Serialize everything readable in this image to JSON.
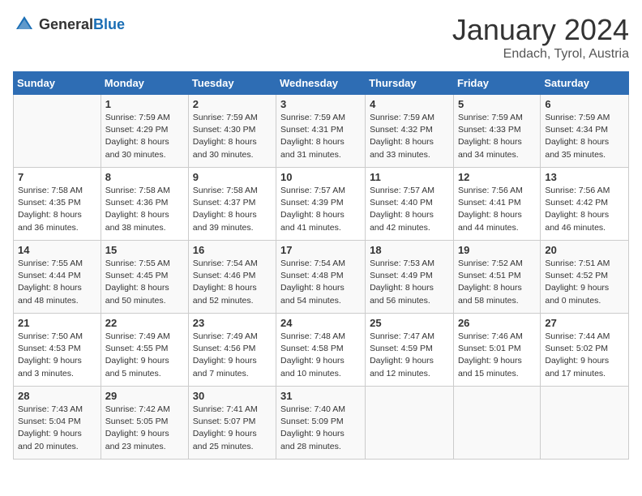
{
  "header": {
    "logo_general": "General",
    "logo_blue": "Blue",
    "title": "January 2024",
    "subtitle": "Endach, Tyrol, Austria"
  },
  "days_of_week": [
    "Sunday",
    "Monday",
    "Tuesday",
    "Wednesday",
    "Thursday",
    "Friday",
    "Saturday"
  ],
  "weeks": [
    [
      {
        "day": "",
        "info": ""
      },
      {
        "day": "1",
        "info": "Sunrise: 7:59 AM\nSunset: 4:29 PM\nDaylight: 8 hours\nand 30 minutes."
      },
      {
        "day": "2",
        "info": "Sunrise: 7:59 AM\nSunset: 4:30 PM\nDaylight: 8 hours\nand 30 minutes."
      },
      {
        "day": "3",
        "info": "Sunrise: 7:59 AM\nSunset: 4:31 PM\nDaylight: 8 hours\nand 31 minutes."
      },
      {
        "day": "4",
        "info": "Sunrise: 7:59 AM\nSunset: 4:32 PM\nDaylight: 8 hours\nand 33 minutes."
      },
      {
        "day": "5",
        "info": "Sunrise: 7:59 AM\nSunset: 4:33 PM\nDaylight: 8 hours\nand 34 minutes."
      },
      {
        "day": "6",
        "info": "Sunrise: 7:59 AM\nSunset: 4:34 PM\nDaylight: 8 hours\nand 35 minutes."
      }
    ],
    [
      {
        "day": "7",
        "info": "Sunrise: 7:58 AM\nSunset: 4:35 PM\nDaylight: 8 hours\nand 36 minutes."
      },
      {
        "day": "8",
        "info": "Sunrise: 7:58 AM\nSunset: 4:36 PM\nDaylight: 8 hours\nand 38 minutes."
      },
      {
        "day": "9",
        "info": "Sunrise: 7:58 AM\nSunset: 4:37 PM\nDaylight: 8 hours\nand 39 minutes."
      },
      {
        "day": "10",
        "info": "Sunrise: 7:57 AM\nSunset: 4:39 PM\nDaylight: 8 hours\nand 41 minutes."
      },
      {
        "day": "11",
        "info": "Sunrise: 7:57 AM\nSunset: 4:40 PM\nDaylight: 8 hours\nand 42 minutes."
      },
      {
        "day": "12",
        "info": "Sunrise: 7:56 AM\nSunset: 4:41 PM\nDaylight: 8 hours\nand 44 minutes."
      },
      {
        "day": "13",
        "info": "Sunrise: 7:56 AM\nSunset: 4:42 PM\nDaylight: 8 hours\nand 46 minutes."
      }
    ],
    [
      {
        "day": "14",
        "info": "Sunrise: 7:55 AM\nSunset: 4:44 PM\nDaylight: 8 hours\nand 48 minutes."
      },
      {
        "day": "15",
        "info": "Sunrise: 7:55 AM\nSunset: 4:45 PM\nDaylight: 8 hours\nand 50 minutes."
      },
      {
        "day": "16",
        "info": "Sunrise: 7:54 AM\nSunset: 4:46 PM\nDaylight: 8 hours\nand 52 minutes."
      },
      {
        "day": "17",
        "info": "Sunrise: 7:54 AM\nSunset: 4:48 PM\nDaylight: 8 hours\nand 54 minutes."
      },
      {
        "day": "18",
        "info": "Sunrise: 7:53 AM\nSunset: 4:49 PM\nDaylight: 8 hours\nand 56 minutes."
      },
      {
        "day": "19",
        "info": "Sunrise: 7:52 AM\nSunset: 4:51 PM\nDaylight: 8 hours\nand 58 minutes."
      },
      {
        "day": "20",
        "info": "Sunrise: 7:51 AM\nSunset: 4:52 PM\nDaylight: 9 hours\nand 0 minutes."
      }
    ],
    [
      {
        "day": "21",
        "info": "Sunrise: 7:50 AM\nSunset: 4:53 PM\nDaylight: 9 hours\nand 3 minutes."
      },
      {
        "day": "22",
        "info": "Sunrise: 7:49 AM\nSunset: 4:55 PM\nDaylight: 9 hours\nand 5 minutes."
      },
      {
        "day": "23",
        "info": "Sunrise: 7:49 AM\nSunset: 4:56 PM\nDaylight: 9 hours\nand 7 minutes."
      },
      {
        "day": "24",
        "info": "Sunrise: 7:48 AM\nSunset: 4:58 PM\nDaylight: 9 hours\nand 10 minutes."
      },
      {
        "day": "25",
        "info": "Sunrise: 7:47 AM\nSunset: 4:59 PM\nDaylight: 9 hours\nand 12 minutes."
      },
      {
        "day": "26",
        "info": "Sunrise: 7:46 AM\nSunset: 5:01 PM\nDaylight: 9 hours\nand 15 minutes."
      },
      {
        "day": "27",
        "info": "Sunrise: 7:44 AM\nSunset: 5:02 PM\nDaylight: 9 hours\nand 17 minutes."
      }
    ],
    [
      {
        "day": "28",
        "info": "Sunrise: 7:43 AM\nSunset: 5:04 PM\nDaylight: 9 hours\nand 20 minutes."
      },
      {
        "day": "29",
        "info": "Sunrise: 7:42 AM\nSunset: 5:05 PM\nDaylight: 9 hours\nand 23 minutes."
      },
      {
        "day": "30",
        "info": "Sunrise: 7:41 AM\nSunset: 5:07 PM\nDaylight: 9 hours\nand 25 minutes."
      },
      {
        "day": "31",
        "info": "Sunrise: 7:40 AM\nSunset: 5:09 PM\nDaylight: 9 hours\nand 28 minutes."
      },
      {
        "day": "",
        "info": ""
      },
      {
        "day": "",
        "info": ""
      },
      {
        "day": "",
        "info": ""
      }
    ]
  ]
}
